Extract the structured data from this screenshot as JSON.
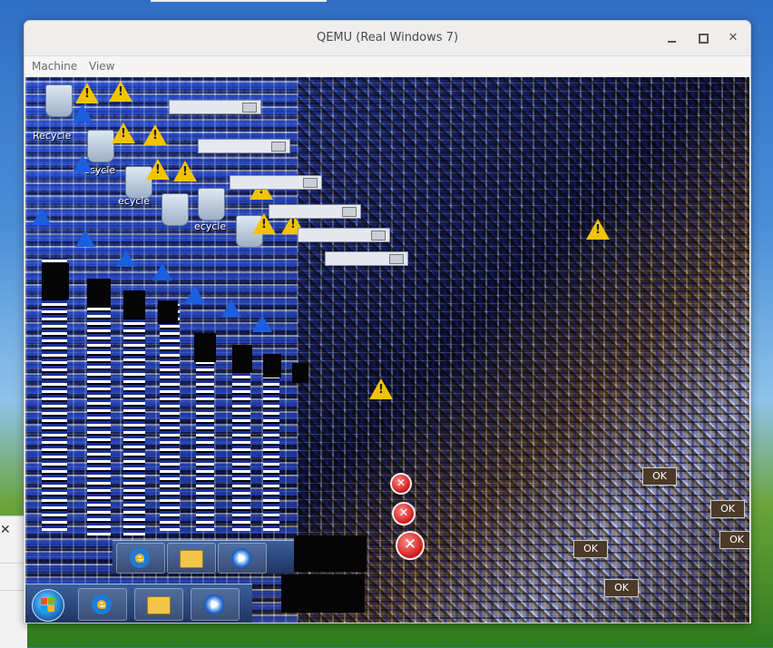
{
  "host": {
    "side_close_glyph": "✕"
  },
  "window": {
    "title": "QEMU (Real Windows 7)",
    "controls": {
      "minimize": "minimize-icon",
      "maximize": "maximize-icon",
      "close": "✕"
    },
    "menu": {
      "machine": "Machine",
      "view": "View"
    }
  },
  "guest": {
    "desktop_label": "Recycle",
    "desktop_label_partial": "ecycle",
    "ok_label": "OK",
    "error_glyph": "✕",
    "warning_glyph": "!",
    "ie_glyph": "e",
    "accent_colors": {
      "warning": "#f2c400",
      "error": "#d01818",
      "taskbar": "#1e3360"
    }
  }
}
